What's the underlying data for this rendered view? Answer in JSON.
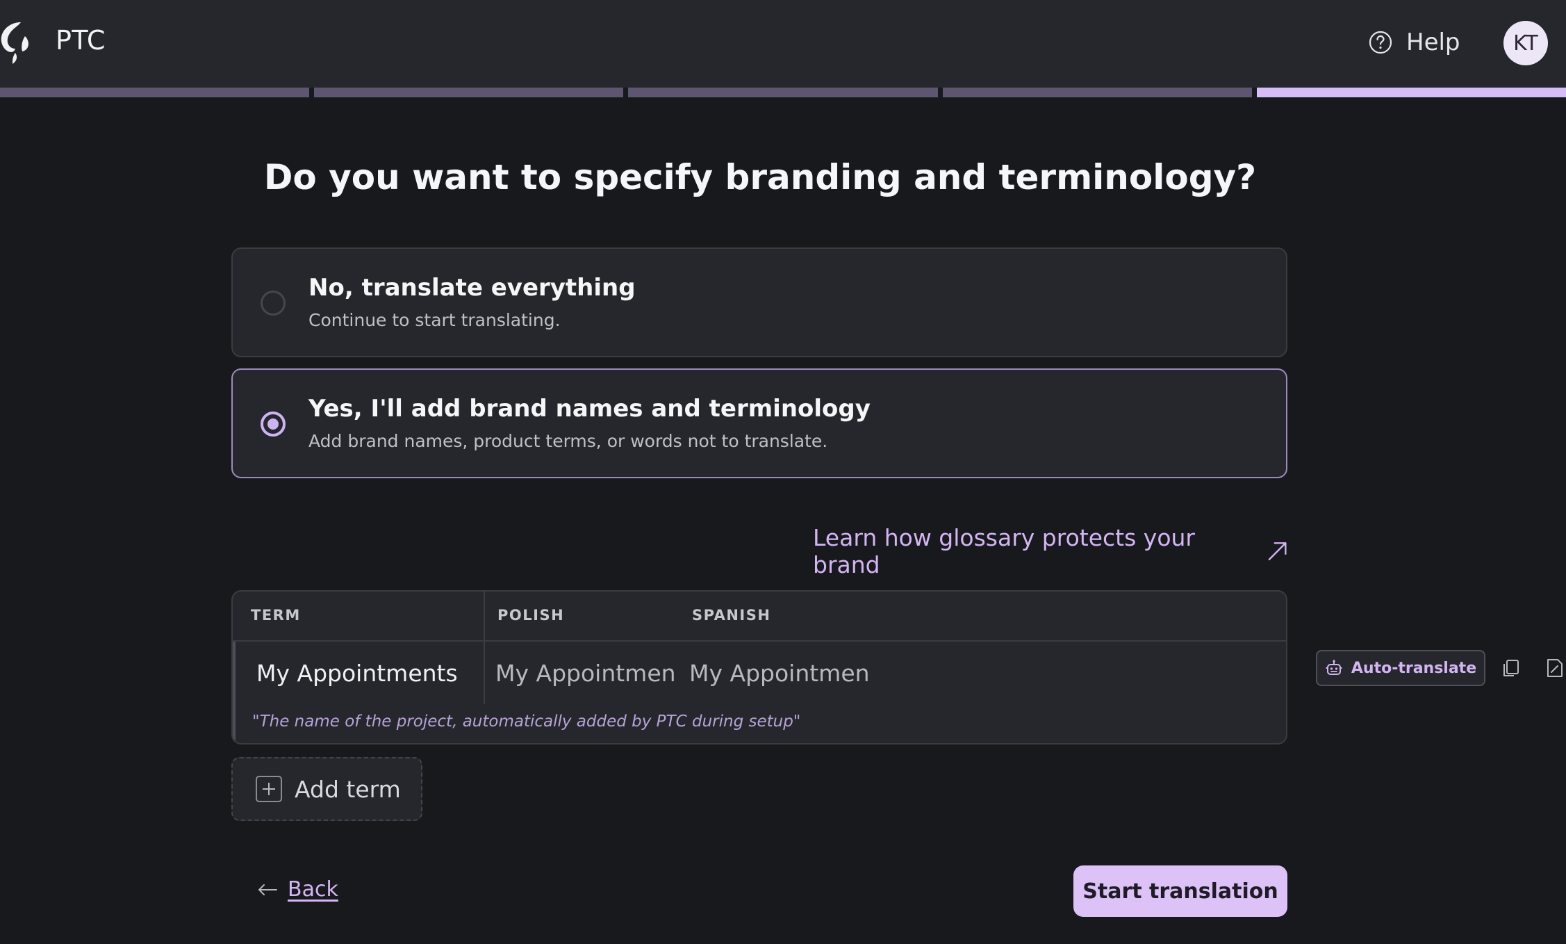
{
  "header": {
    "app_name": "PTC",
    "help_label": "Help",
    "avatar_initials": "KT"
  },
  "progress": {
    "total_steps": 5,
    "current_step": 5
  },
  "page_title": "Do you want to specify branding and terminology?",
  "options": [
    {
      "title": "No, translate everything",
      "subtitle": "Continue to start translating.",
      "selected": false
    },
    {
      "title": "Yes, I'll add brand names and terminology",
      "subtitle": "Add brand names, product terms, or words not to translate.",
      "selected": true
    }
  ],
  "learn_link": "Learn how glossary protects your brand",
  "glossary": {
    "headers": [
      "TERM",
      "POLISH",
      "SPANISH"
    ],
    "rows": [
      {
        "term": "My Appointments",
        "polish": "My Appointments",
        "spanish": "My Appointments",
        "note": "\"The name of the project, automatically added by PTC during setup\""
      }
    ]
  },
  "auto_translate_label": "Auto-translate",
  "add_term_label": "Add term",
  "back_label": "Back",
  "start_label": "Start translation",
  "colors": {
    "accent": "#d3b5f3",
    "background": "#17191c",
    "surface": "#25272c"
  }
}
